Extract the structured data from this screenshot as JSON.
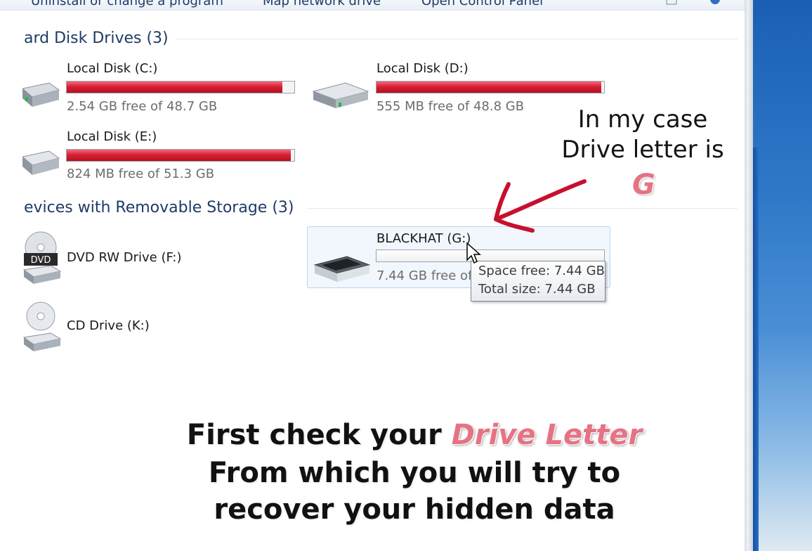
{
  "toolbar": {
    "items": [
      "Uninstall or change a program",
      "Map network drive",
      "Open Control Panel"
    ]
  },
  "groups": {
    "hard_disk": {
      "header": "ard Disk Drives (3)"
    },
    "removable": {
      "header": "evices with Removable Storage (3)"
    }
  },
  "drives": {
    "c": {
      "name": "Local Disk (C:)",
      "free_text": "2.54 GB free of 48.7 GB",
      "used_fraction": 0.948
    },
    "d": {
      "name": "Local Disk (D:)",
      "free_text": "555 MB free of 48.8 GB",
      "used_fraction": 0.989
    },
    "e": {
      "name": "Local Disk (E:)",
      "free_text": "824 MB free of 51.3 GB",
      "used_fraction": 0.984
    },
    "f": {
      "name": "DVD RW Drive (F:)",
      "icon_label": "DVD"
    },
    "g": {
      "name": "BLACKHAT (G:)",
      "free_text": "7.44 GB free of",
      "used_fraction": 0.0
    },
    "k": {
      "name": "CD Drive (K:)"
    }
  },
  "tooltip": {
    "space_free": "Space free: 7.44 GB",
    "total_size": "Total size: 7.44 GB"
  },
  "annotation": {
    "line1": "In my case",
    "line2": "Drive letter is",
    "letter": "G",
    "arrow_color": "#c8102e"
  },
  "caption": {
    "line1_prefix": "First check your ",
    "line1_highlight": "Drive Letter",
    "line2": "From which you will try to",
    "line3": "recover your hidden data",
    "highlight_color": "#e57384"
  },
  "colors": {
    "bar_full": "#d81f36",
    "group_header": "#1e3b66",
    "selection_border": "#b9d4ee"
  }
}
